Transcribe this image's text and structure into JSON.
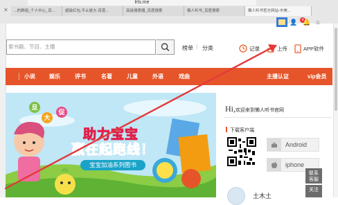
{
  "browser": {
    "url": "lrts.me",
    "tabs": [
      {
        "label": "...的群组_个人中心_百..."
      },
      {
        "label": "超级红包,不止是大-百度..."
      },
      {
        "label": "高级搜索器_百度搜索"
      },
      {
        "label": "懒人听书_百度搜索"
      },
      {
        "label": "懒人听书官方网站-中美..."
      }
    ],
    "toolbar_badge": "4"
  },
  "header": {
    "search_placeholder": "索书籍、节目、主播",
    "nav_rank": "榜单",
    "nav_sep": "|",
    "nav_category": "分类",
    "history_label": "记录",
    "upload_label": "上传",
    "app_label": "APP软件"
  },
  "nav": {
    "items": [
      "小说",
      "娱乐",
      "评书",
      "名著",
      "儿童",
      "外语",
      "戏曲"
    ],
    "right_items": [
      "主播认证",
      "vip会员"
    ]
  },
  "banner": {
    "deco_chars": [
      "旦",
      "大",
      "促"
    ],
    "title_line1": "助力宝宝",
    "title_line2": "赢在起跑线！",
    "subtitle": "宝宝加油系列图书"
  },
  "right_panel": {
    "greeting_hi": "Hi,",
    "greeting_text": "欢迎来到懒人听书官网",
    "download_title": "下载客户端",
    "stores": [
      "Android",
      "iphone"
    ],
    "user_name": "土木土"
  },
  "float": {
    "contact": [
      "联系",
      "客服"
    ],
    "follow": [
      "关注"
    ]
  },
  "colors": {
    "brand": "#e6552a",
    "annotation_arrow": "#e23a3a"
  }
}
